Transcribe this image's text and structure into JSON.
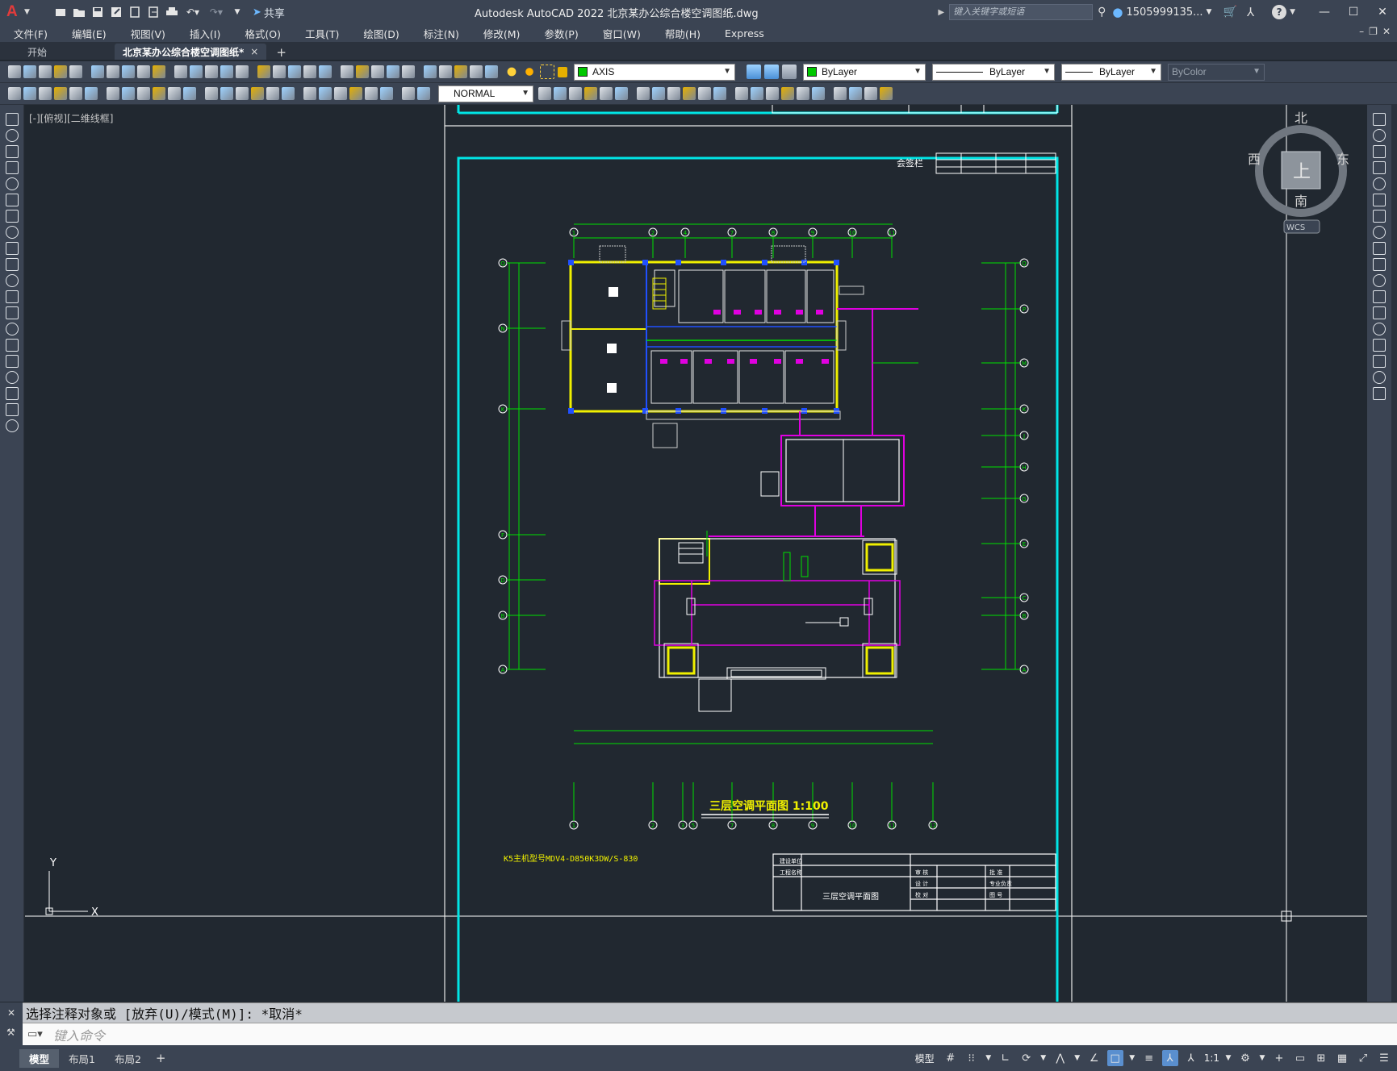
{
  "titlebar": {
    "app_logo": "A",
    "share_label": "共享",
    "title": "Autodesk AutoCAD 2022    北京某办公综合楼空调图纸.dwg",
    "search_placeholder": "键入关键字或短语",
    "user_name": "1505999135..."
  },
  "menu": {
    "items": [
      "文件(F)",
      "编辑(E)",
      "视图(V)",
      "插入(I)",
      "格式(O)",
      "工具(T)",
      "绘图(D)",
      "标注(N)",
      "修改(M)",
      "参数(P)",
      "窗口(W)",
      "帮助(H)",
      "Express"
    ]
  },
  "tabs": {
    "start": "开始",
    "active": "北京某办公综合楼空调图纸*",
    "close": "×",
    "add": "+"
  },
  "toolbar": {
    "layer": "AXIS",
    "color": "ByLayer",
    "linetype": "ByLayer",
    "lineweight": "ByLayer",
    "plotstyle": "ByColor",
    "dimstyle": "NORMAL"
  },
  "viewport": {
    "label": "[-][俯视][二维线框]"
  },
  "viewcube": {
    "north": "北",
    "south": "南",
    "east": "东",
    "west": "西",
    "top": "上",
    "wcs": "WCS"
  },
  "drawing": {
    "title": "三层空调平面图  1:100",
    "note": "K5主机型号MDV4-D850K3DW/S-830",
    "sign_label": "会签栏",
    "titleblock_name": "三层空调平面图",
    "titleblock_rows": [
      "建设单位",
      "工程名称"
    ],
    "titleblock_cells": [
      "审 核",
      "设 计",
      "校 对",
      "批 准",
      "专业负责",
      "图 号"
    ],
    "axis_labels_top": [
      "1",
      "2",
      "4",
      "7",
      "8",
      "9",
      "10",
      "11"
    ],
    "axis_labels_bottom": [
      "1",
      "2",
      "3",
      "5",
      "7",
      "8",
      "9",
      "10",
      "11",
      "12"
    ],
    "axis_labels_left": [
      "Q",
      "N",
      "K",
      "F",
      "D",
      "B",
      "A"
    ],
    "axis_labels_right": [
      "Q",
      "P",
      "M",
      "K",
      "J",
      "H",
      "G",
      "E",
      "C",
      "B",
      "A"
    ],
    "ucs_x": "X",
    "ucs_y": "Y"
  },
  "command": {
    "history": "选择注释对象或 [放弃(U)/模式(M)]: *取消*",
    "placeholder": "键入命令"
  },
  "status": {
    "model": "模型",
    "layout1": "布局1",
    "layout2": "布局2",
    "model_btn": "模型",
    "scale": "1:1"
  },
  "colors": {
    "accent_cyan": "#00e5e5",
    "wall_yellow": "#f0f000",
    "axis_green": "#00e000",
    "duct_magenta": "#e000e0",
    "blue": "#2050ff"
  }
}
